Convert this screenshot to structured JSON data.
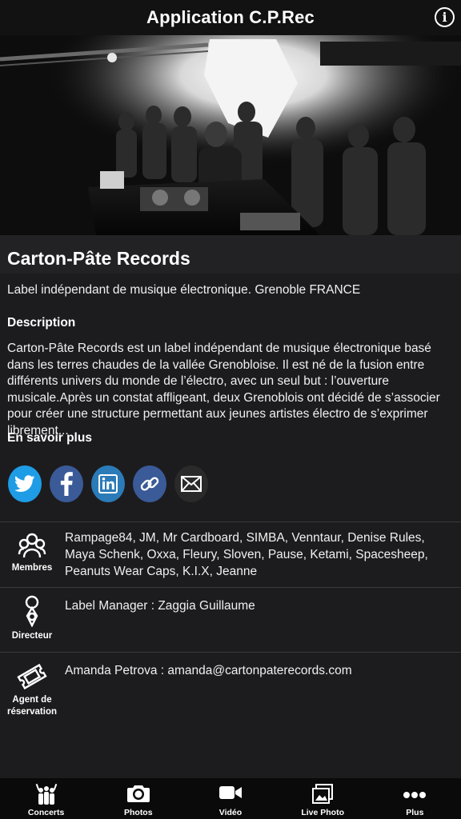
{
  "header": {
    "title": "Application C.P.Rec",
    "info_icon": "info-icon"
  },
  "hero": {
    "image": "dj-performance-photo"
  },
  "band": {
    "name": "Carton-Pâte Records",
    "tagline": "Label indépendant de musique électronique. Grenoble FRANCE"
  },
  "description": {
    "heading": "Description",
    "text": "Carton-Pâte Records est un label indépendant de musique électronique basé dans les terres chaudes de la vallée Grenobloise. Il est né de la fusion entre différents univers du monde de l’électro, avec un seul but : l’ouverture musicale.Après un constat affligeant, deux Grenoblois ont décidé de s’associer pour créer une structure permettant aux jeunes artistes électro de s’exprimer librement..."
  },
  "more": {
    "heading": "En savoir plus",
    "socials": [
      {
        "icon": "twitter-icon",
        "color": "#1e9ce6"
      },
      {
        "icon": "facebook-icon",
        "color": "#3a5a98"
      },
      {
        "icon": "linkedin-icon",
        "color": "#2b7bb8"
      },
      {
        "icon": "link-icon",
        "color": "#3a5a98"
      },
      {
        "icon": "mail-icon",
        "color": "#2a2a2a"
      }
    ]
  },
  "members": {
    "label": "Membres",
    "text": "Rampage84, JM, Mr Cardboard, SIMBA, Venntaur, Denise Rules, Maya Schenk, Oxxa, Fleury, Sloven, Pause, Ketami, Spacesheep, Peanuts Wear Caps, K.I.X, Jeanne"
  },
  "director": {
    "label": "Directeur",
    "text": "Label Manager : Zaggia Guillaume"
  },
  "agent": {
    "label_line1": "Agent de",
    "label_line2": "réservation",
    "text": "Amanda Petrova : amanda@cartonpaterecords.com"
  },
  "tabs": [
    {
      "label": "Concerts",
      "icon": "concert-crowd-icon"
    },
    {
      "label": "Photos",
      "icon": "camera-icon"
    },
    {
      "label": "Vidéo",
      "icon": "video-camera-icon"
    },
    {
      "label": "Live Photo",
      "icon": "photo-stack-icon"
    },
    {
      "label": "Plus",
      "icon": "more-dots-icon"
    }
  ]
}
